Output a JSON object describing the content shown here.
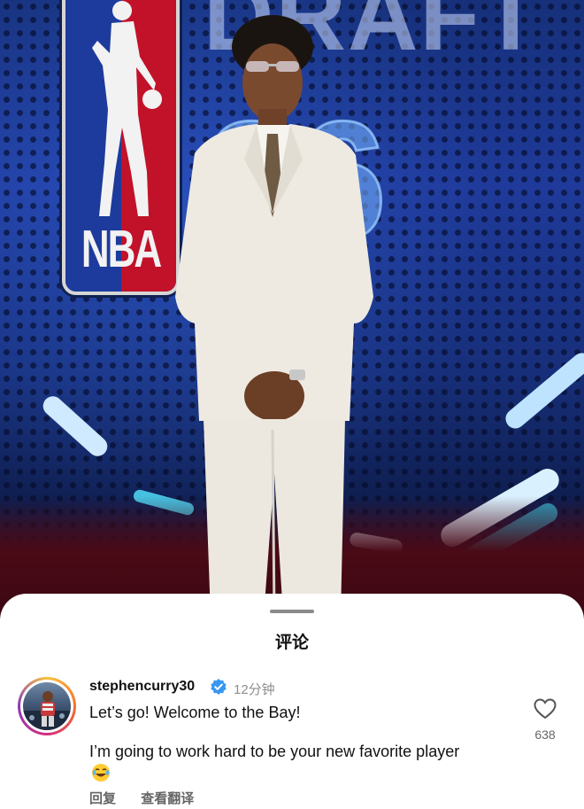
{
  "photo": {
    "nba_wordmark": "NBA",
    "banner_title": "DRAFT",
    "banner_year": "26"
  },
  "comments_sheet": {
    "title": "评论",
    "comment": {
      "username": "stephencurry30",
      "time_ago": "12分钟",
      "line1": "Let’s go! Welcome to the Bay!",
      "line2": "I’m going to work hard to be your new favorite player",
      "emoji": "laughing-tears-emoji",
      "actions": {
        "reply": "回复",
        "translate": "查看翻译"
      },
      "like_count": "638"
    }
  },
  "colors": {
    "verified_blue": "#3897f0",
    "avatar_ring": [
      "#f9c13a",
      "#f36f2a",
      "#d62d7b",
      "#8a3ab9"
    ]
  }
}
